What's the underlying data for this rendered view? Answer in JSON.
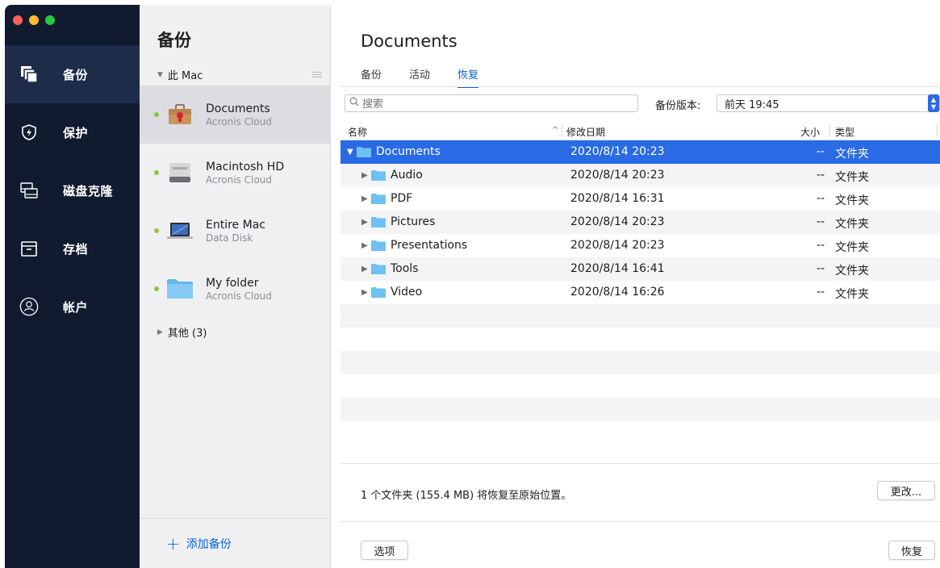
{
  "nav": {
    "items": [
      {
        "label": "备份",
        "icon": "backup-icon",
        "active": true
      },
      {
        "label": "保护",
        "icon": "shield-icon",
        "active": false
      },
      {
        "label": "磁盘克隆",
        "icon": "disk-clone-icon",
        "active": false
      },
      {
        "label": "存档",
        "icon": "archive-icon",
        "active": false
      },
      {
        "label": "帐户",
        "icon": "account-icon",
        "active": false
      }
    ]
  },
  "list": {
    "title": "备份",
    "group_label": "此 Mac",
    "items": [
      {
        "name": "Documents",
        "sub": "Acronis Cloud",
        "icon": "briefcase-icon",
        "selected": true
      },
      {
        "name": "Macintosh HD",
        "sub": "Acronis Cloud",
        "icon": "hard-drive-icon",
        "selected": false
      },
      {
        "name": "Entire Mac",
        "sub": "Data Disk",
        "icon": "laptop-icon",
        "selected": false
      },
      {
        "name": "My folder",
        "sub": "Acronis Cloud",
        "icon": "folder-icon",
        "selected": false
      }
    ],
    "others_label": "其他 (3)",
    "add_label": "添加备份"
  },
  "detail": {
    "title": "Documents",
    "tabs": [
      {
        "label": "备份",
        "active": false
      },
      {
        "label": "活动",
        "active": false
      },
      {
        "label": "恢复",
        "active": true
      }
    ],
    "search_placeholder": "搜索",
    "version_label": "备份版本:",
    "version_value": "前天 19:45",
    "columns": {
      "name": "名称",
      "date": "修改日期",
      "size": "大小",
      "type": "类型"
    },
    "rows": [
      {
        "name": "Documents",
        "date": "2020/8/14 20:23",
        "size": "--",
        "type": "文件夹",
        "expanded": true,
        "indent": 0,
        "selected": true
      },
      {
        "name": "Audio",
        "date": "2020/8/14 20:23",
        "size": "--",
        "type": "文件夹",
        "expanded": false,
        "indent": 1,
        "selected": false
      },
      {
        "name": "PDF",
        "date": "2020/8/14 16:31",
        "size": "--",
        "type": "文件夹",
        "expanded": false,
        "indent": 1,
        "selected": false
      },
      {
        "name": "Pictures",
        "date": "2020/8/14 20:23",
        "size": "--",
        "type": "文件夹",
        "expanded": false,
        "indent": 1,
        "selected": false
      },
      {
        "name": "Presentations",
        "date": "2020/8/14 20:23",
        "size": "--",
        "type": "文件夹",
        "expanded": false,
        "indent": 1,
        "selected": false
      },
      {
        "name": "Tools",
        "date": "2020/8/14 16:41",
        "size": "--",
        "type": "文件夹",
        "expanded": false,
        "indent": 1,
        "selected": false
      },
      {
        "name": "Video",
        "date": "2020/8/14 16:26",
        "size": "--",
        "type": "文件夹",
        "expanded": false,
        "indent": 1,
        "selected": false
      }
    ],
    "summary": "1 个文件夹 (155.4 MB) 将恢复至原始位置。",
    "change_label": "更改...",
    "options_label": "选项",
    "recover_label": "恢复"
  },
  "colors": {
    "accent": "#0a64d6",
    "selection": "#2a6ae4",
    "rail": "#101b2f",
    "rail_active": "#1e2c4a",
    "status_dot": "#8fc43f",
    "folder": "#6ec1f0"
  }
}
